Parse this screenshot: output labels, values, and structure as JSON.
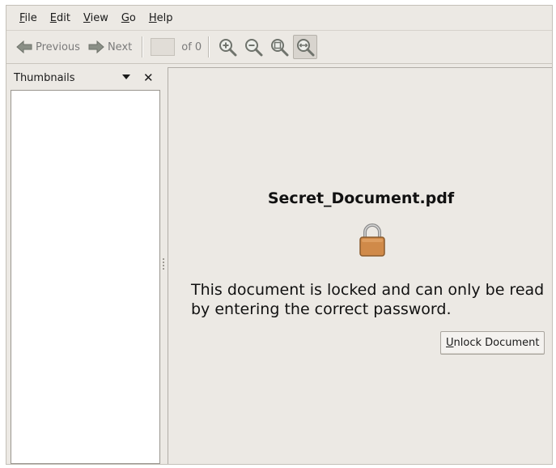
{
  "menubar": {
    "items": [
      {
        "mnemonic": "F",
        "rest": "ile"
      },
      {
        "mnemonic": "E",
        "rest": "dit"
      },
      {
        "mnemonic": "V",
        "rest": "iew"
      },
      {
        "mnemonic": "G",
        "rest": "o"
      },
      {
        "mnemonic": "H",
        "rest": "elp"
      }
    ]
  },
  "toolbar": {
    "previous_label": "Previous",
    "next_label": "Next",
    "page_value": "",
    "of_label": "of 0",
    "icons": [
      "zoom-in-icon",
      "zoom-out-icon",
      "best-fit-icon",
      "fit-width-icon"
    ]
  },
  "sidebar": {
    "title": "Thumbnails",
    "close_glyph": "✕"
  },
  "document": {
    "filename": "Secret_Document.pdf",
    "message": "This document is locked and can only be read by entering the correct password.",
    "unlock_mnemonic": "U",
    "unlock_rest": "nlock Document"
  },
  "colors": {
    "window_bg": "#ece9e4",
    "lock_body": "#d08a49",
    "disabled_text": "#7a7a7a"
  }
}
